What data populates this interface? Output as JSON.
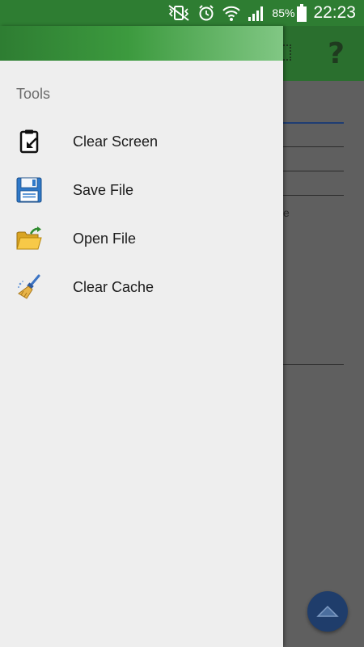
{
  "status_bar": {
    "battery_percent": "85%",
    "time": "22:23",
    "icons": [
      "mute-vibrate-icon",
      "alarm-icon",
      "wifi-icon",
      "signal-icon",
      "battery-icon"
    ]
  },
  "toolbar": {
    "help_glyph": "?"
  },
  "drawer": {
    "section_title": "Tools",
    "items": [
      {
        "label": "Clear Screen",
        "icon": "clipboard-clear-icon"
      },
      {
        "label": "Save File",
        "icon": "floppy-disk-icon"
      },
      {
        "label": "Open File",
        "icon": "open-folder-icon"
      },
      {
        "label": "Clear Cache",
        "icon": "broom-icon"
      }
    ]
  },
  "background": {
    "partial_text": "e"
  },
  "colors": {
    "status_bar": "#2e7d32",
    "drawer_background": "#eeeeee",
    "scrim": "#5f5f5f",
    "fab": "#1f3d6b"
  }
}
